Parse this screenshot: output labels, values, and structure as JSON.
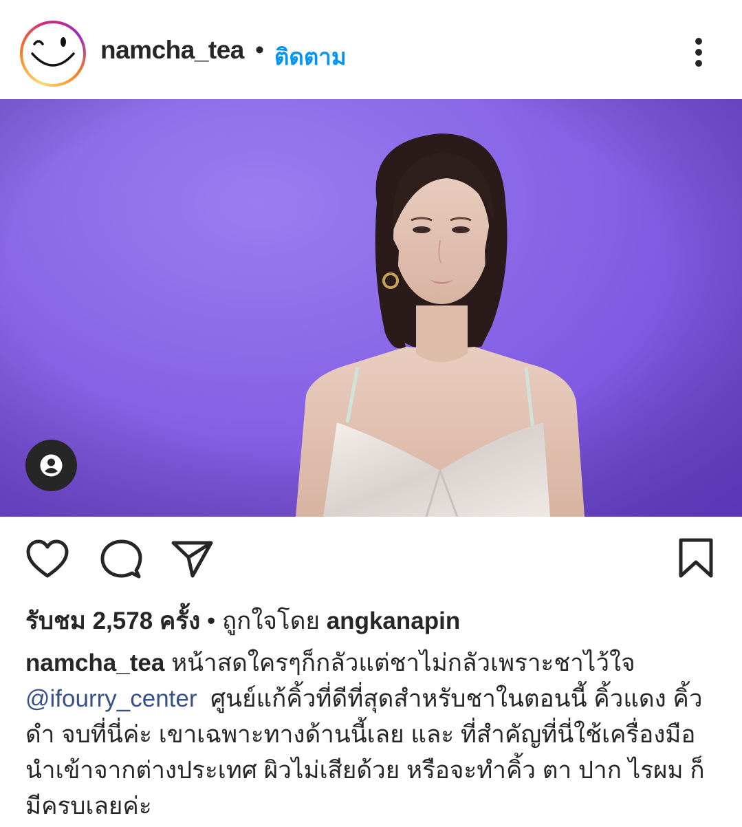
{
  "header": {
    "username": "namcha_tea",
    "separator": "•",
    "follow_label": "ติดตาม",
    "more_icon": "more-vertical-icon"
  },
  "media": {
    "tag_icon": "user-tag-icon"
  },
  "actions": {
    "like_icon": "heart-icon",
    "comment_icon": "comment-icon",
    "share_icon": "send-icon",
    "save_icon": "bookmark-icon"
  },
  "stats": {
    "views_prefix": "รับชม",
    "views_count": "2,578",
    "views_suffix": "ครั้ง",
    "separator": "•",
    "liked_by_label": "ถูกใจโดย",
    "liked_by_user": "angkanapin"
  },
  "caption": {
    "author": "namcha_tea",
    "text_1": "หน้าสดใครๆก็กลัวแต่ชาไม่กลัวเพราะชาไว้ใจ",
    "mention": "@ifourry_center",
    "text_2": "ศูนย์แก้คิ้วที่ดีที่สุดสำหรับชาในตอนนี้ คิ้วแดง คิ้วดำ จบที่นี่ค่ะ เขาเฉพาะทางด้านนี้เลย  และ ที่สำคัญที่นี่ใช้เครื่องมือนำเข้าจากต่างประเทศ ผิวไม่เสียด้วย  หรือจะทำคิ้ว ตา ปาก ไรผม ก็มีครบเลยค่ะ"
  },
  "colors": {
    "link_blue": "#0095f6",
    "mention_blue": "#385185",
    "background_purple": "#8b6ae8"
  }
}
